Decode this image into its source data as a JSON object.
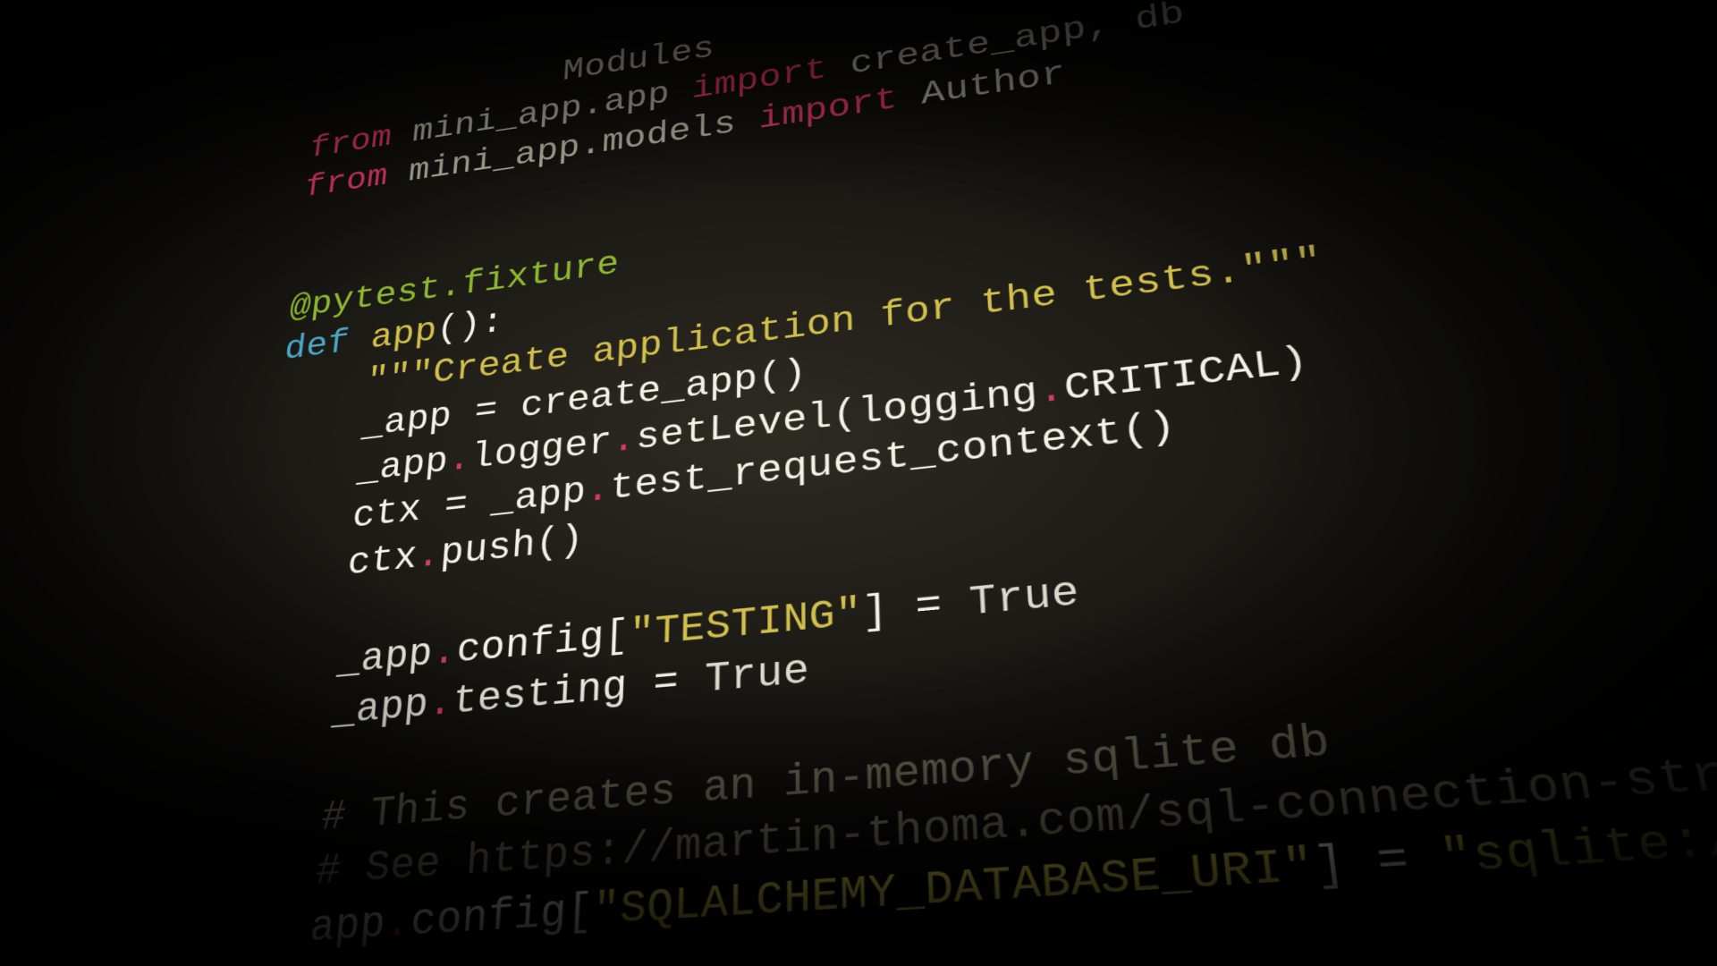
{
  "code": {
    "l0_comment_tail": "Modules",
    "l1": {
      "from": "from",
      "mod": "mini_app.app",
      "import": "import",
      "names": "create_app, db"
    },
    "l2": {
      "from": "from",
      "mod": "mini_app.models",
      "import": "import",
      "names": "Author"
    },
    "decorator": "@pytest.fixture",
    "def_kw": "def",
    "fn_name": "app",
    "fn_paren": "()",
    "colon": ":",
    "docstring": "\"\"\"Create application for the tests.\"\"\"",
    "l_app_assign": {
      "lhs": "_app",
      "eq": " = ",
      "rhs": "create_app()"
    },
    "l_logger": {
      "a": "_app",
      "d1": ".",
      "b": "logger",
      "d2": ".",
      "c": "setLevel(logging",
      "d3": ".",
      "e": "CRITICAL)"
    },
    "l_ctx_assign": {
      "lhs": "ctx",
      "eq": " = ",
      "a": "_app",
      "d1": ".",
      "b": "test_request_context()"
    },
    "l_ctx_push": {
      "a": "ctx",
      "d1": ".",
      "b": "push()"
    },
    "l_cfg_testing": {
      "a": "_app",
      "d1": ".",
      "b": "config[",
      "s": "\"TESTING\"",
      "c": "] = ",
      "v": "True"
    },
    "l_testing_attr": {
      "a": "_app",
      "d1": ".",
      "b": "testing",
      "eq": " = ",
      "v": "True"
    },
    "c1": "# This creates an in-memory sqlite db",
    "c2": "# See https://martin-thoma.com/sql-connection-strings/",
    "l_cfg_db": {
      "a": "app",
      "d1": ".",
      "b": "config[",
      "s": "\"SQLALCHEMY_DATABASE_URI\"",
      "c": "] = ",
      "v": "\"sqlite://\""
    }
  }
}
